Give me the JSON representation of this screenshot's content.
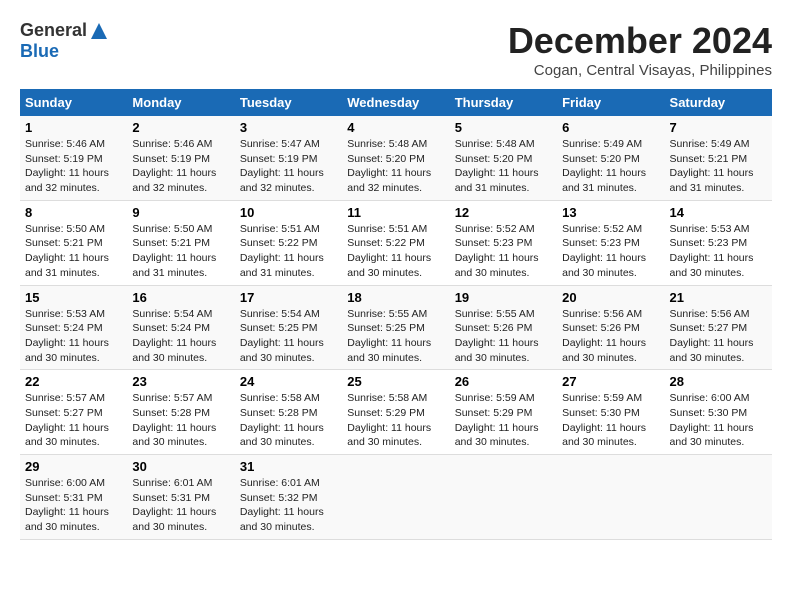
{
  "logo": {
    "general": "General",
    "blue": "Blue"
  },
  "title": "December 2024",
  "subtitle": "Cogan, Central Visayas, Philippines",
  "headers": [
    "Sunday",
    "Monday",
    "Tuesday",
    "Wednesday",
    "Thursday",
    "Friday",
    "Saturday"
  ],
  "weeks": [
    [
      {
        "day": "1",
        "info": "Sunrise: 5:46 AM\nSunset: 5:19 PM\nDaylight: 11 hours\nand 32 minutes."
      },
      {
        "day": "2",
        "info": "Sunrise: 5:46 AM\nSunset: 5:19 PM\nDaylight: 11 hours\nand 32 minutes."
      },
      {
        "day": "3",
        "info": "Sunrise: 5:47 AM\nSunset: 5:19 PM\nDaylight: 11 hours\nand 32 minutes."
      },
      {
        "day": "4",
        "info": "Sunrise: 5:48 AM\nSunset: 5:20 PM\nDaylight: 11 hours\nand 32 minutes."
      },
      {
        "day": "5",
        "info": "Sunrise: 5:48 AM\nSunset: 5:20 PM\nDaylight: 11 hours\nand 31 minutes."
      },
      {
        "day": "6",
        "info": "Sunrise: 5:49 AM\nSunset: 5:20 PM\nDaylight: 11 hours\nand 31 minutes."
      },
      {
        "day": "7",
        "info": "Sunrise: 5:49 AM\nSunset: 5:21 PM\nDaylight: 11 hours\nand 31 minutes."
      }
    ],
    [
      {
        "day": "8",
        "info": "Sunrise: 5:50 AM\nSunset: 5:21 PM\nDaylight: 11 hours\nand 31 minutes."
      },
      {
        "day": "9",
        "info": "Sunrise: 5:50 AM\nSunset: 5:21 PM\nDaylight: 11 hours\nand 31 minutes."
      },
      {
        "day": "10",
        "info": "Sunrise: 5:51 AM\nSunset: 5:22 PM\nDaylight: 11 hours\nand 31 minutes."
      },
      {
        "day": "11",
        "info": "Sunrise: 5:51 AM\nSunset: 5:22 PM\nDaylight: 11 hours\nand 30 minutes."
      },
      {
        "day": "12",
        "info": "Sunrise: 5:52 AM\nSunset: 5:23 PM\nDaylight: 11 hours\nand 30 minutes."
      },
      {
        "day": "13",
        "info": "Sunrise: 5:52 AM\nSunset: 5:23 PM\nDaylight: 11 hours\nand 30 minutes."
      },
      {
        "day": "14",
        "info": "Sunrise: 5:53 AM\nSunset: 5:23 PM\nDaylight: 11 hours\nand 30 minutes."
      }
    ],
    [
      {
        "day": "15",
        "info": "Sunrise: 5:53 AM\nSunset: 5:24 PM\nDaylight: 11 hours\nand 30 minutes."
      },
      {
        "day": "16",
        "info": "Sunrise: 5:54 AM\nSunset: 5:24 PM\nDaylight: 11 hours\nand 30 minutes."
      },
      {
        "day": "17",
        "info": "Sunrise: 5:54 AM\nSunset: 5:25 PM\nDaylight: 11 hours\nand 30 minutes."
      },
      {
        "day": "18",
        "info": "Sunrise: 5:55 AM\nSunset: 5:25 PM\nDaylight: 11 hours\nand 30 minutes."
      },
      {
        "day": "19",
        "info": "Sunrise: 5:55 AM\nSunset: 5:26 PM\nDaylight: 11 hours\nand 30 minutes."
      },
      {
        "day": "20",
        "info": "Sunrise: 5:56 AM\nSunset: 5:26 PM\nDaylight: 11 hours\nand 30 minutes."
      },
      {
        "day": "21",
        "info": "Sunrise: 5:56 AM\nSunset: 5:27 PM\nDaylight: 11 hours\nand 30 minutes."
      }
    ],
    [
      {
        "day": "22",
        "info": "Sunrise: 5:57 AM\nSunset: 5:27 PM\nDaylight: 11 hours\nand 30 minutes."
      },
      {
        "day": "23",
        "info": "Sunrise: 5:57 AM\nSunset: 5:28 PM\nDaylight: 11 hours\nand 30 minutes."
      },
      {
        "day": "24",
        "info": "Sunrise: 5:58 AM\nSunset: 5:28 PM\nDaylight: 11 hours\nand 30 minutes."
      },
      {
        "day": "25",
        "info": "Sunrise: 5:58 AM\nSunset: 5:29 PM\nDaylight: 11 hours\nand 30 minutes."
      },
      {
        "day": "26",
        "info": "Sunrise: 5:59 AM\nSunset: 5:29 PM\nDaylight: 11 hours\nand 30 minutes."
      },
      {
        "day": "27",
        "info": "Sunrise: 5:59 AM\nSunset: 5:30 PM\nDaylight: 11 hours\nand 30 minutes."
      },
      {
        "day": "28",
        "info": "Sunrise: 6:00 AM\nSunset: 5:30 PM\nDaylight: 11 hours\nand 30 minutes."
      }
    ],
    [
      {
        "day": "29",
        "info": "Sunrise: 6:00 AM\nSunset: 5:31 PM\nDaylight: 11 hours\nand 30 minutes."
      },
      {
        "day": "30",
        "info": "Sunrise: 6:01 AM\nSunset: 5:31 PM\nDaylight: 11 hours\nand 30 minutes."
      },
      {
        "day": "31",
        "info": "Sunrise: 6:01 AM\nSunset: 5:32 PM\nDaylight: 11 hours\nand 30 minutes."
      },
      {
        "day": "",
        "info": ""
      },
      {
        "day": "",
        "info": ""
      },
      {
        "day": "",
        "info": ""
      },
      {
        "day": "",
        "info": ""
      }
    ]
  ]
}
